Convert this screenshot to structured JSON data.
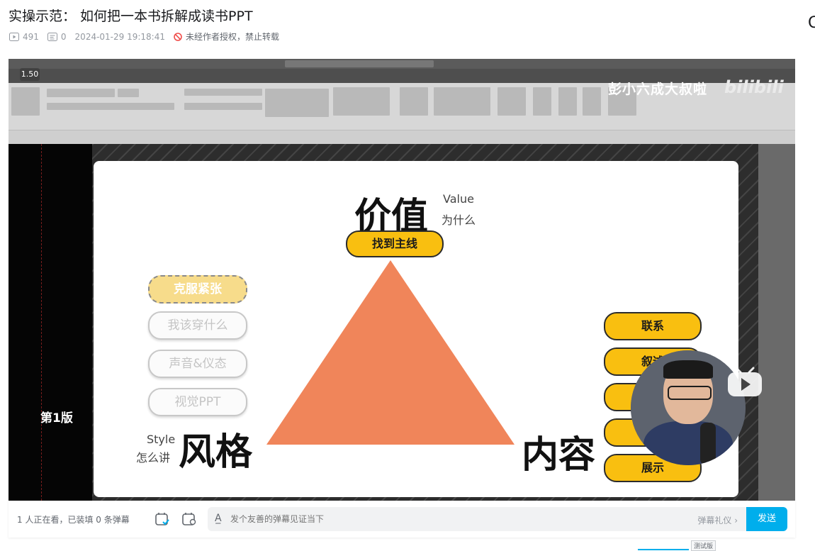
{
  "video": {
    "title": "实操示范： 如何把一本书拆解成读书PPT",
    "views": "491",
    "danmaku_count": "0",
    "datetime": "2024-01-29 19:18:41",
    "copyright": "未经作者授权，禁止转载"
  },
  "player": {
    "speed_tag": "1.50",
    "uploader_watermark": "彭小六成大叔啦",
    "brand_watermark": "bilibili",
    "slide_version": "第1版"
  },
  "slide": {
    "top": {
      "title": "价值",
      "en": "Value",
      "cn": "为什么",
      "pill": "找到主线"
    },
    "left": {
      "title": "风格",
      "en": "Style",
      "cn": "怎么讲",
      "pills": [
        "克服紧张",
        "我该穿什么",
        "声音&仪态",
        "视觉PPT"
      ]
    },
    "right": {
      "title": "内容",
      "pills": [
        "联系",
        "叙述",
        "",
        "",
        "展示"
      ]
    },
    "triangle_color": "#f0855a",
    "pill_color": "#f9bf10"
  },
  "danmaku_bar": {
    "watching": "1 人正在看，已装填 0 条弹幕",
    "placeholder": "发个友善的弹幕见证当下",
    "gift_label": "弹幕礼仪 ›",
    "send_label": "发送",
    "accent": "#00aeec"
  },
  "footer": {
    "test_tag": "测试版"
  }
}
